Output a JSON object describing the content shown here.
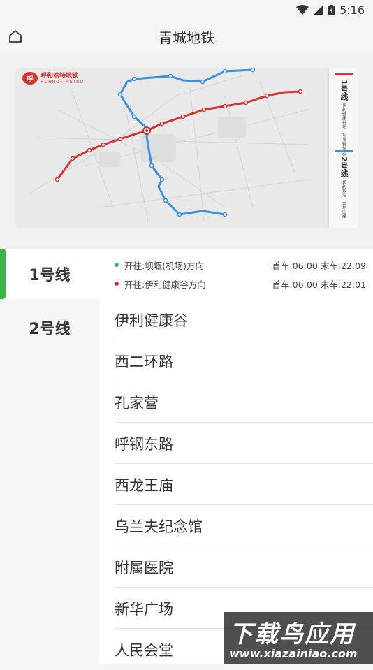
{
  "status_bar": {
    "time": "5:16"
  },
  "app_bar": {
    "title": "青城地铁",
    "home_icon": "home-icon"
  },
  "map": {
    "logo": {
      "cn": "呼和浩特地铁",
      "en": "HOHHOT METRO",
      "mark": "呼"
    },
    "legend": [
      {
        "num": "1号线",
        "sub": "伊利健康谷站—坝堰(机场)站",
        "color": "#d6332f"
      },
      {
        "num": "2号线",
        "sub": "塔利东站—奔尔山路",
        "color": "#3a8fe0"
      }
    ],
    "line1_color": "#d6332f",
    "line2_color": "#3a8fe0"
  },
  "lines_nav": [
    {
      "label": "1号线",
      "active": true
    },
    {
      "label": "2号线",
      "active": false
    }
  ],
  "directions": [
    {
      "dot_color": "#3cb54a",
      "text": "开往:坝堰(机场)方向",
      "time": "首车:06:00  末车:22:09"
    },
    {
      "dot_color": "#e0312c",
      "text": "开往:伊利健康谷方向",
      "time": "首车:06:00  末车:22:01"
    }
  ],
  "stations": [
    "伊利健康谷",
    "西二环路",
    "孔家营",
    "呼钢东路",
    "西龙王庙",
    "乌兰夫纪念馆",
    "附属医院",
    "新华广场",
    "人民会堂"
  ],
  "watermark": {
    "main": "下载鸟应用",
    "url": "www.xiazainiao.com"
  }
}
